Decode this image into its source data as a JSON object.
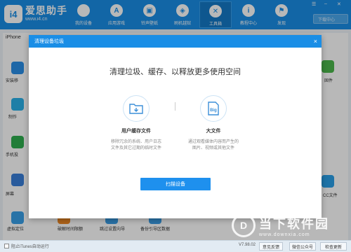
{
  "app": {
    "brand_name": "爱思助手",
    "brand_url": "www.i4.cn",
    "logo_text": "i4"
  },
  "nav": [
    {
      "label": "我的设备",
      "icon": "apple-icon",
      "glyph": ""
    },
    {
      "label": "应用游戏",
      "icon": "app-store-icon",
      "glyph": "A"
    },
    {
      "label": "铃声壁纸",
      "icon": "tv-icon",
      "glyph": "▣"
    },
    {
      "label": "刷机越狱",
      "icon": "box-icon",
      "glyph": "◈"
    },
    {
      "label": "工具箱",
      "icon": "tools-icon",
      "glyph": "✕"
    },
    {
      "label": "教程中心",
      "icon": "info-icon",
      "glyph": "i"
    },
    {
      "label": "发现",
      "icon": "flag-icon",
      "glyph": "⚑"
    }
  ],
  "download_label": "下载中心",
  "device_tab": "iPhone",
  "background": {
    "left_labels": [
      "安装移",
      "制作",
      "手机投",
      "屏幕",
      "虚拟定位"
    ],
    "bottom_items": [
      "破解时间限额",
      "跳过设置向导",
      "备份引导区数据"
    ],
    "right_labels": [
      "固件",
      "CC文件"
    ]
  },
  "modal": {
    "title": "清理设备垃圾",
    "close_glyph": "×",
    "heading": "清理垃圾、缓存、以释放更多使用空间",
    "options": [
      {
        "title": "用户缓存文件",
        "desc": "移除冗余的系统、用户日志\n文件及其它过期的临时文件",
        "icon": "folder-icon"
      },
      {
        "title": "大文件",
        "desc": "通过观看媒体内容而产生的\n图片、视频或其他文件",
        "icon": "big-file-icon",
        "badge": "Big"
      }
    ],
    "scan_button": "扫描设备"
  },
  "statusbar": {
    "itunes_label": "阻止iTunes自动运行",
    "version": "V7.98.02",
    "feedback_btn": "意见反馈",
    "wechat_btn": "微信公众号",
    "update_btn": "检查更新"
  },
  "watermark": {
    "main": "当下软件园",
    "sub": "www.downxia.com",
    "glyph": "D"
  },
  "colors": {
    "brand": "#1a8ee6",
    "button": "#1e90ee"
  }
}
